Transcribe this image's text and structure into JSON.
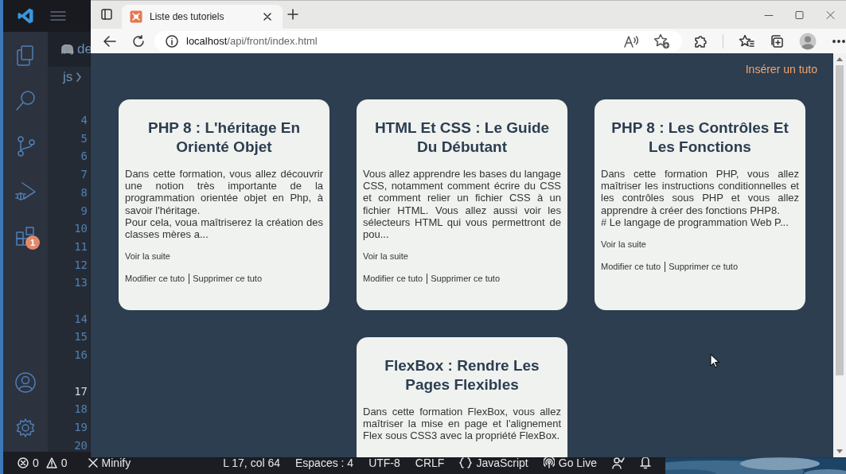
{
  "activity_bar": {
    "extensions_badge": "1"
  },
  "editor": {
    "tab": "de",
    "breadcrumb": "js",
    "line_numbers": [
      {
        "number": "4",
        "current": false,
        "wrapped": false
      },
      {
        "number": "5",
        "current": false,
        "wrapped": false
      },
      {
        "number": "6",
        "current": false,
        "wrapped": false
      },
      {
        "number": "7",
        "current": false,
        "wrapped": false
      },
      {
        "number": "8",
        "current": false,
        "wrapped": false
      },
      {
        "number": "9",
        "current": false,
        "wrapped": false
      },
      {
        "number": "10",
        "current": false,
        "wrapped": false
      },
      {
        "number": "11",
        "current": false,
        "wrapped": false
      },
      {
        "number": "12",
        "current": false,
        "wrapped": false
      },
      {
        "number": "13",
        "current": false,
        "wrapped": true
      },
      {
        "number": "14",
        "current": false,
        "wrapped": false
      },
      {
        "number": "15",
        "current": false,
        "wrapped": false
      },
      {
        "number": "16",
        "current": false,
        "wrapped": true
      },
      {
        "number": "17",
        "current": true,
        "wrapped": false
      },
      {
        "number": "18",
        "current": false,
        "wrapped": false
      },
      {
        "number": "19",
        "current": false,
        "wrapped": false
      },
      {
        "number": "20",
        "current": false,
        "wrapped": false
      }
    ]
  },
  "status_bar": {
    "left": [
      {
        "kind": "problems",
        "errors": "0",
        "warnings": "0"
      },
      {
        "kind": "minify",
        "text": "Minify"
      }
    ],
    "right": [
      {
        "kind": "text",
        "text": "L 17, col 64"
      },
      {
        "kind": "text",
        "text": "Espaces : 4"
      },
      {
        "kind": "text",
        "text": "UTF-8"
      },
      {
        "kind": "text",
        "text": "CRLF"
      },
      {
        "kind": "language",
        "text": "JavaScript"
      },
      {
        "kind": "live",
        "text": "Go Live"
      },
      {
        "kind": "feedback"
      },
      {
        "kind": "notifications"
      }
    ]
  },
  "browser": {
    "tabs": [
      {
        "title": "Liste des tutoriels",
        "selected": true
      }
    ],
    "url_host": "localhost",
    "url_path": "/api/front/index.html"
  },
  "page": {
    "insert_link": "Insérer un tuto",
    "cards": [
      {
        "title": "PHP 8 : L'héritage En Orienté Objet",
        "description": "Dans cette formation, vous allez découvrir une notion très importante de la programmation orientée objet en Php, à savoir l'héritage.\nPour cela, voua maîtriserez la création des classes mères a...",
        "read_more": "Voir la suite",
        "edit": "Modifier ce tuto",
        "delete": "Supprimer ce tuto"
      },
      {
        "title": "HTML Et CSS : Le Guide Du Débutant",
        "description": "Vous allez apprendre les bases du langage CSS, notamment comment écrire du CSS et comment relier un fichier CSS à un fichier HTML. Vous allez aussi voir les sélecteurs HTML qui vous permettront de pou...",
        "read_more": "Voir la suite",
        "edit": "Modifier ce tuto",
        "delete": "Supprimer ce tuto"
      },
      {
        "title": "PHP 8 : Les Contrôles Et Les Fonctions",
        "description": "Dans cette formation PHP, vous allez maîtriser les instructions conditionnelles et les contrôles sous PHP et vous allez apprendre à créer des fonctions PHP8.\n# Le langage de programmation Web P...",
        "read_more": "Voir la suite",
        "edit": "Modifier ce tuto",
        "delete": "Supprimer ce tuto"
      },
      {
        "title": "FlexBox : Rendre Les Pages Flexibles",
        "description": "Dans cette formation FlexBox, vous allez maîtriser la mise en page et l'alignement Flex sous CSS3 avec la propriété FlexBox."
      }
    ]
  }
}
